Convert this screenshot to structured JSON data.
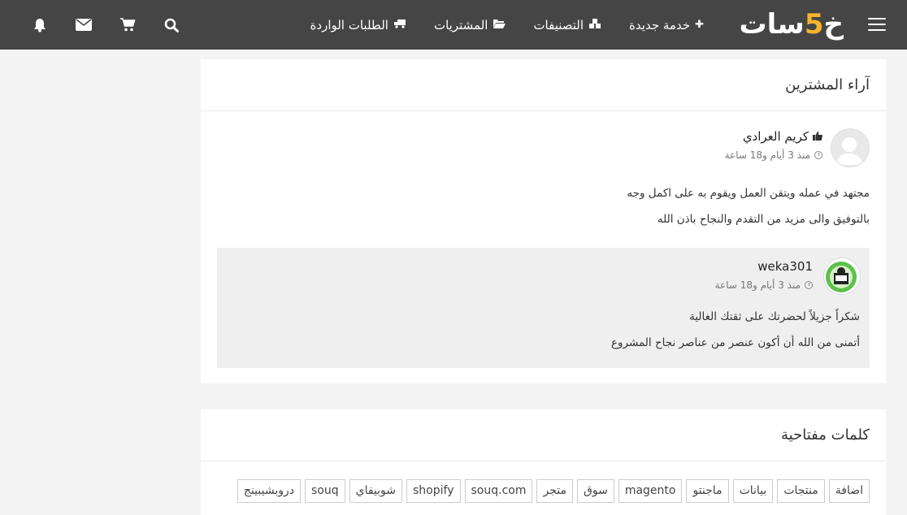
{
  "brand": {
    "name": "خمسات",
    "accent": "#f7b42c",
    "navbar_bg": "#454545"
  },
  "nav": {
    "links": [
      {
        "label": "خدمة جديدة",
        "icon": "plus-icon"
      },
      {
        "label": "التصنيفات",
        "icon": "cubes-icon"
      },
      {
        "label": "المشتريات",
        "icon": "folder-open-icon"
      },
      {
        "label": "الطلبات الواردة",
        "icon": "truck-icon"
      }
    ],
    "icons": [
      "bell-icon",
      "envelope-icon",
      "cart-icon",
      "search-icon"
    ]
  },
  "reviews": {
    "title": "آراء المشترين",
    "review": {
      "author": "كريم العرادي",
      "time": "منذ 3 أيام و18 ساعة",
      "lines": [
        "مجتهد في عمله ويتقن العمل ويقوم به على اكمل وجه",
        "بالتوفيق والى مزيد من التقدم والنجاح باذن الله"
      ]
    },
    "reply": {
      "author": "weka301",
      "time": "منذ 3 أيام و18 ساعة",
      "lines": [
        "شكراً جزيلاً لحضرتك على ثقتك الغالية",
        "أتمنى من الله أن أكون عنصر من عناصر نجاح المشروع"
      ]
    }
  },
  "keywords": {
    "title": "كلمات مفتاحية",
    "tags": [
      "اضافة",
      "منتجات",
      "بيانات",
      "ماجنتو",
      "magento",
      "سوق",
      "متجر",
      "souq.com",
      "shopify",
      "شوبيفاي",
      "souq",
      "دروبشيبينج"
    ]
  }
}
